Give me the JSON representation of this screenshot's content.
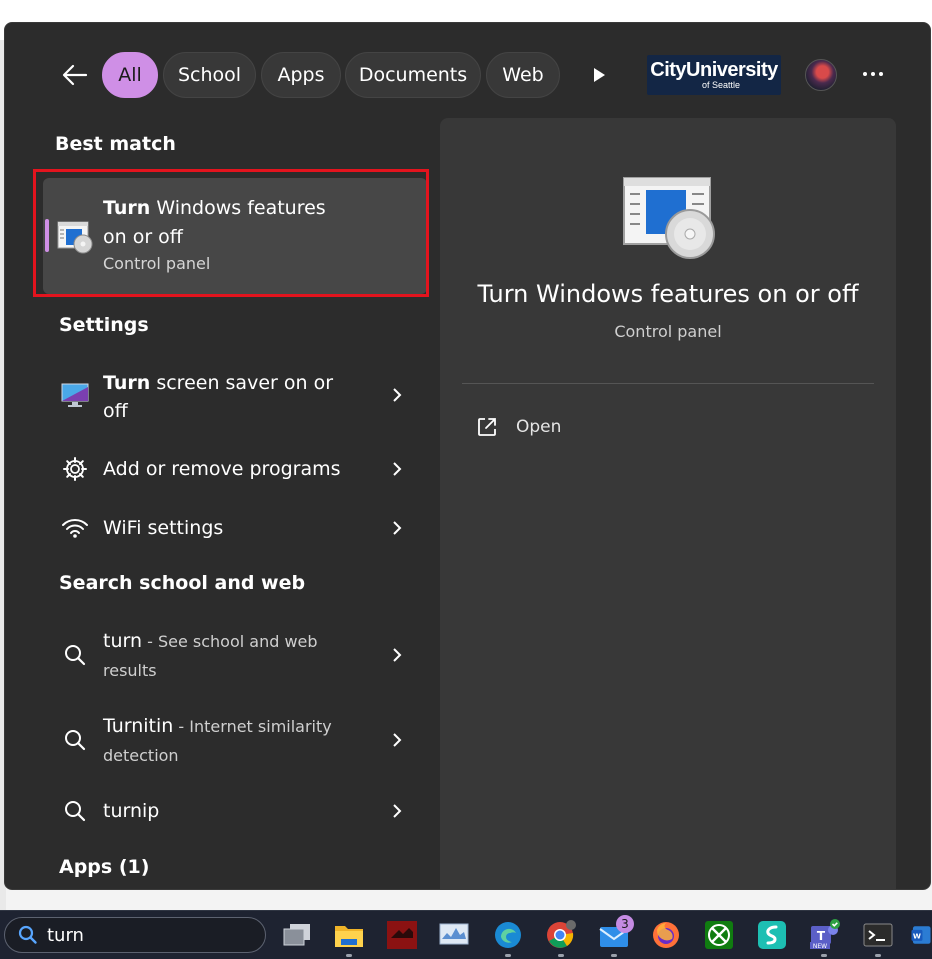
{
  "filters": {
    "tabs": [
      "All",
      "School",
      "Apps",
      "Documents",
      "Web"
    ],
    "active": "All"
  },
  "org": {
    "logo_line1": "CityUniversity",
    "logo_line2": "of Seattle"
  },
  "best_match": {
    "heading": "Best match",
    "title_bold": "Turn",
    "title_rest": " Windows features",
    "title_line2": "on or off",
    "subtitle": "Control panel"
  },
  "settings": {
    "heading": "Settings",
    "items": [
      {
        "bold": "Turn",
        "rest": " screen saver on or",
        "line2": "off",
        "icon": "monitor-icon"
      },
      {
        "bold": "",
        "rest": "Add or remove programs",
        "line2": "",
        "icon": "gear-icon"
      },
      {
        "bold": "",
        "rest": "WiFi settings",
        "line2": "",
        "icon": "wifi-icon"
      }
    ]
  },
  "web": {
    "heading": "Search school and web",
    "items": [
      {
        "bold": "turn",
        "rest": " - See school and web",
        "line2": "results"
      },
      {
        "bold": "Turnitin",
        "rest": " - Internet similarity",
        "line2": "detection"
      },
      {
        "bold": "turnip",
        "rest": "",
        "line2": ""
      }
    ]
  },
  "apps": {
    "heading": "Apps (1)"
  },
  "preview": {
    "title": "Turn Windows features on or off",
    "subtitle": "Control panel",
    "action_open": "Open"
  },
  "taskbar": {
    "search_value": "turn",
    "mail_badge": "3",
    "apps": [
      "task-view-icon",
      "file-explorer-icon",
      "app-red-icon",
      "monitor-app-icon",
      "edge-icon",
      "chrome-icon",
      "mail-icon",
      "firefox-icon",
      "xbox-icon",
      "surfshark-icon",
      "teams-icon",
      "terminal-icon",
      "word-icon"
    ]
  },
  "colors": {
    "accent": "#cf8fe6",
    "highlight": "#e3141e",
    "panel": "#2c2c2c",
    "preview": "#383838"
  }
}
